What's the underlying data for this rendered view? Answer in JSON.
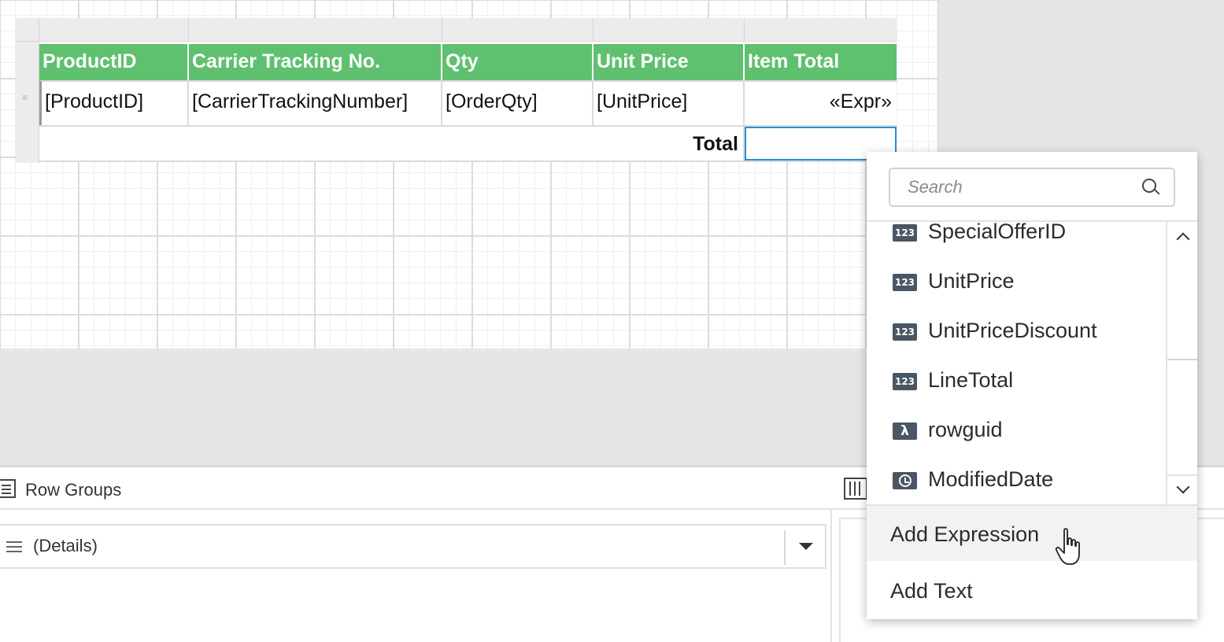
{
  "tablix": {
    "header": [
      "ProductID",
      "Carrier Tracking No.",
      "Qty",
      "Unit Price",
      "Item Total"
    ],
    "detail": [
      "[ProductID]",
      "[CarrierTrackingNumber]",
      "[OrderQty]",
      "[UnitPrice]",
      "«Expr»"
    ],
    "total_label": "Total",
    "header_color": "#5fc06f",
    "selected_border_color": "#2a8fd0"
  },
  "groups": {
    "row_groups_label": "Row Groups",
    "details_label": "(Details)"
  },
  "popup": {
    "search_placeholder": "Search",
    "fields": [
      {
        "label": "SpecialOfferID",
        "icon": "number-icon",
        "glyph": "123"
      },
      {
        "label": "UnitPrice",
        "icon": "number-icon",
        "glyph": "123"
      },
      {
        "label": "UnitPriceDiscount",
        "icon": "number-icon",
        "glyph": "123"
      },
      {
        "label": "LineTotal",
        "icon": "number-icon",
        "glyph": "123"
      },
      {
        "label": "rowguid",
        "icon": "expression-icon",
        "glyph": "λ"
      },
      {
        "label": "ModifiedDate",
        "icon": "clock-icon",
        "glyph": ""
      }
    ],
    "actions": {
      "add_expression": "Add Expression",
      "add_text": "Add Text"
    }
  }
}
